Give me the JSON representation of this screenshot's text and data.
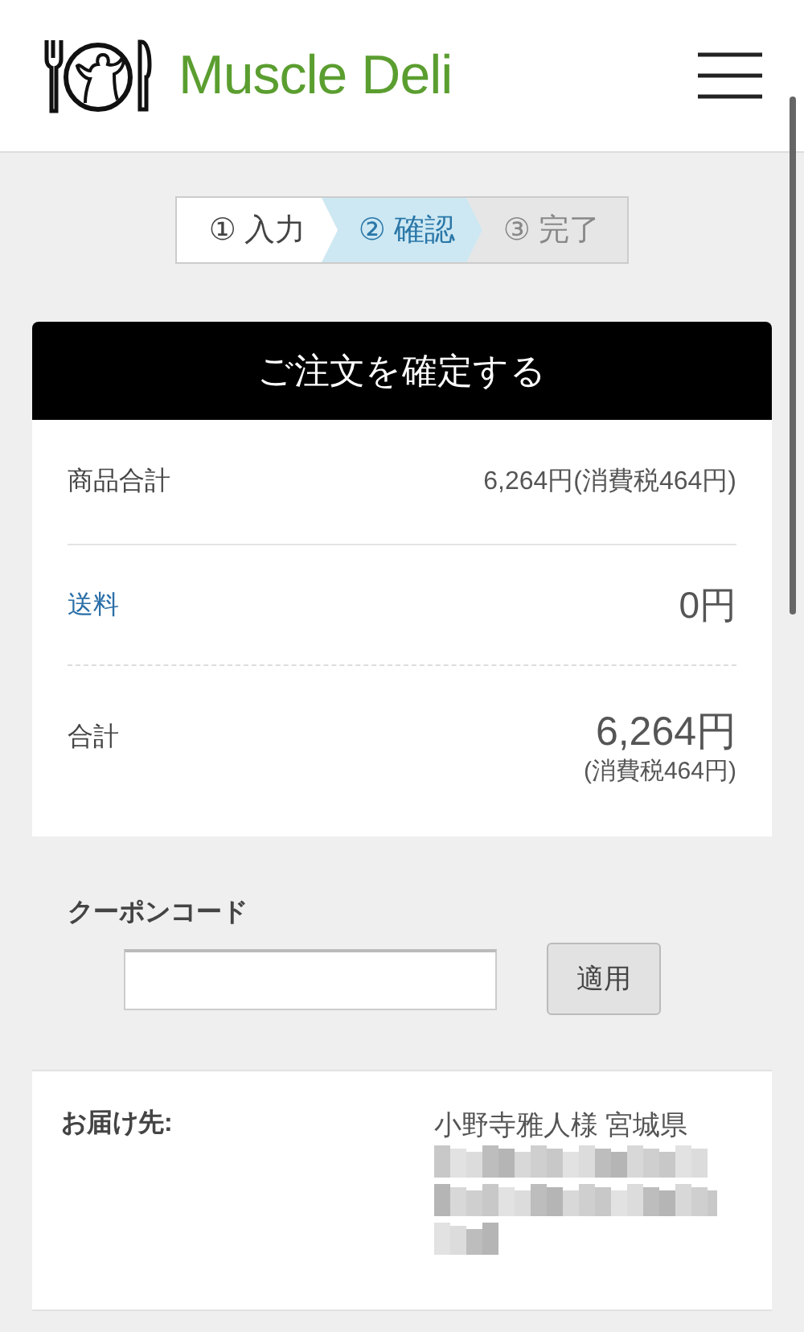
{
  "header": {
    "brand": "Muscle Deli"
  },
  "steps": [
    {
      "label": "① 入力",
      "kind": "done"
    },
    {
      "label": "② 確認",
      "kind": "current"
    },
    {
      "label": "③ 完了",
      "kind": "pending"
    }
  ],
  "confirm_button": "ご注文を確定する",
  "summary": [
    {
      "kind": "subtotal",
      "label": "商品合計",
      "value": "6,264円(消費税464円)"
    },
    {
      "kind": "shipping",
      "label": "送料",
      "value": "0円"
    },
    {
      "kind": "total",
      "label": "合計",
      "value": "6,264円",
      "note": "(消費税464円)"
    }
  ],
  "coupon": {
    "label": "クーポンコード",
    "button": "適用"
  },
  "delivery": {
    "label": "お届け先:",
    "recipient": "小野寺雅人様 宮城県",
    "redacted": true
  }
}
